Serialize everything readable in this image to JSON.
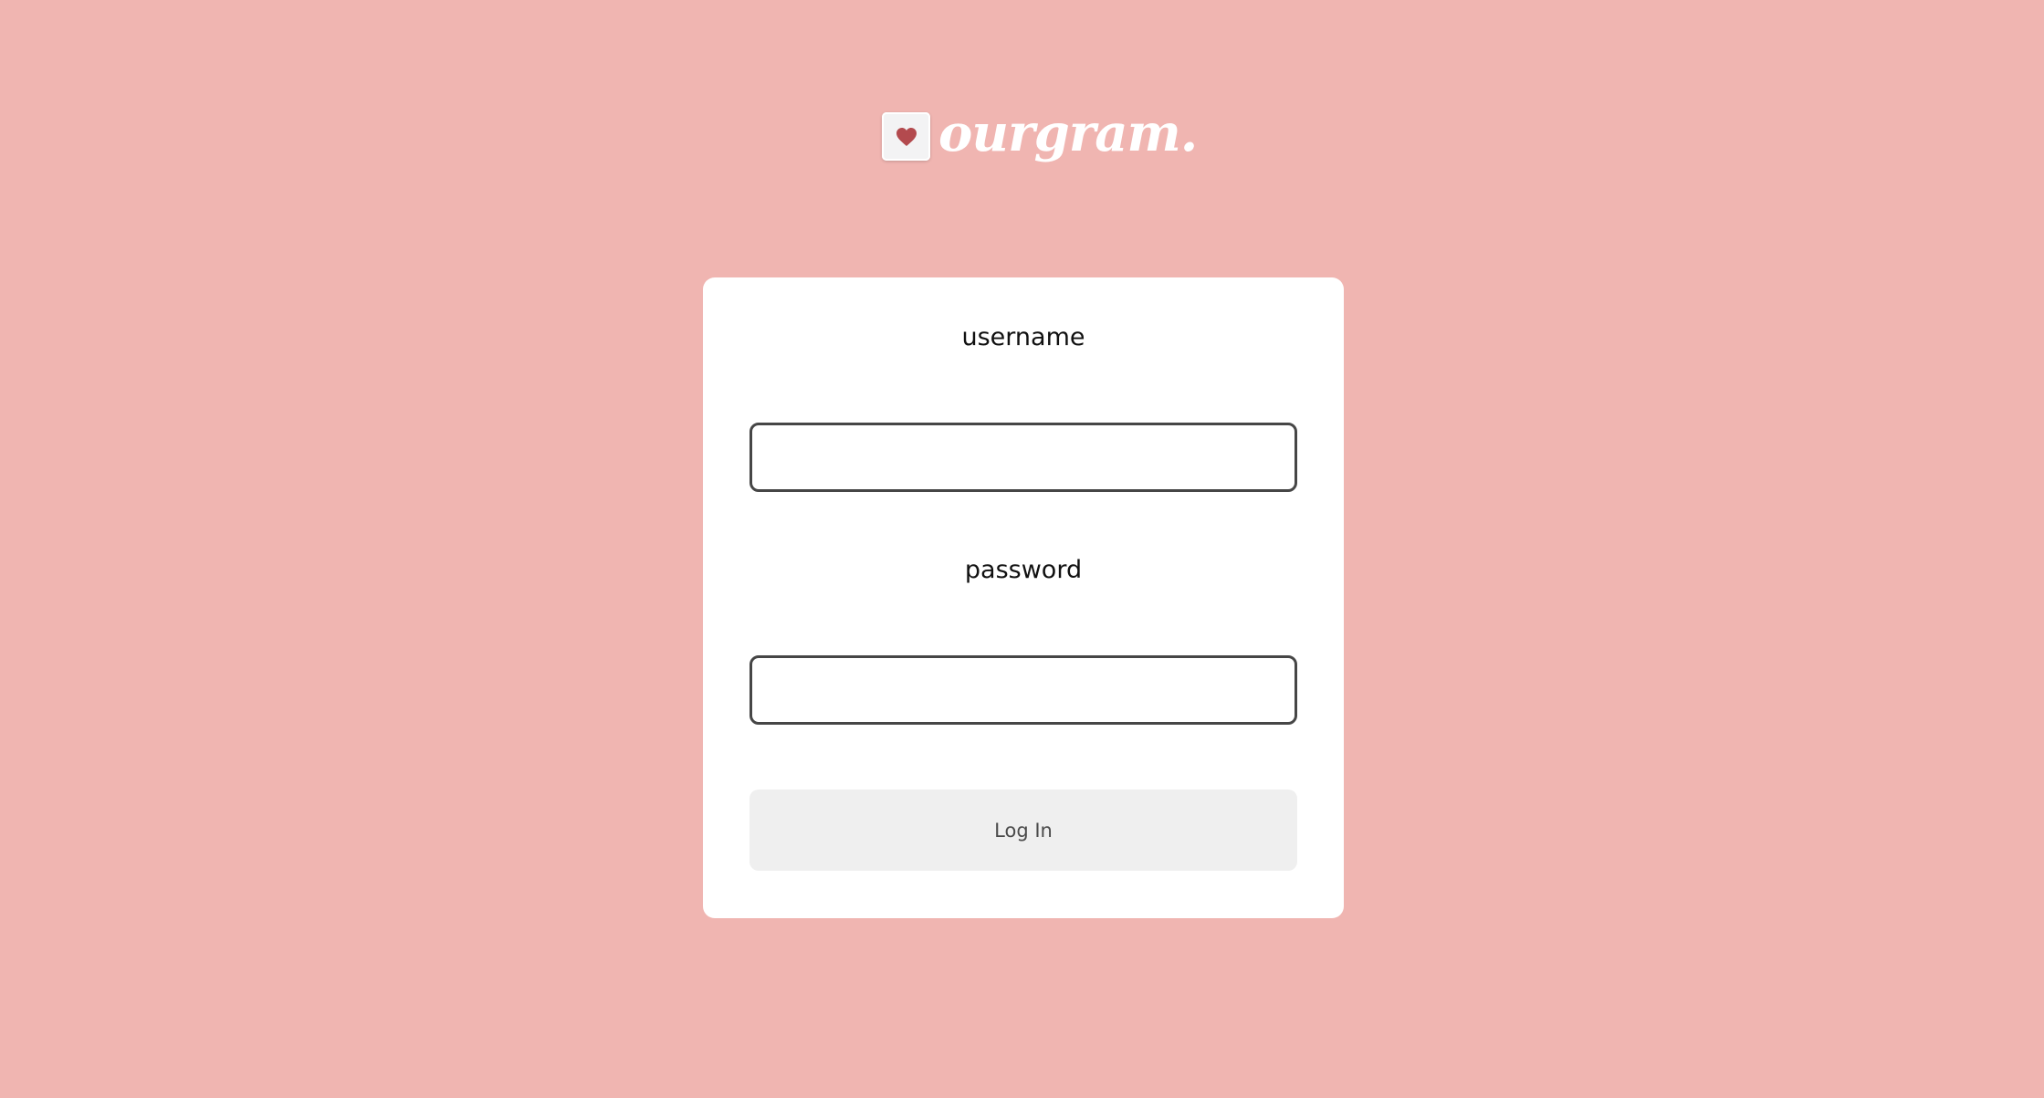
{
  "brand": {
    "name": "ourgram.",
    "icon": "heart-icon",
    "heart_color": "#b34a4e",
    "background_color": "#f0b5b1"
  },
  "login_form": {
    "username_label": "username",
    "username_value": "",
    "password_label": "password",
    "password_value": "",
    "submit_label": "Log In"
  }
}
